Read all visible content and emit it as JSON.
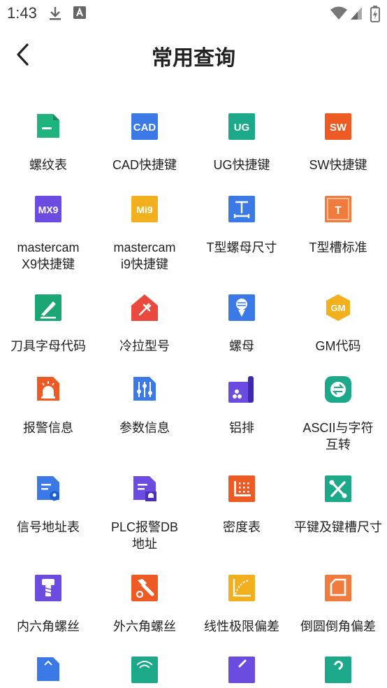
{
  "status": {
    "time": "1:43"
  },
  "header": {
    "title": "常用查询"
  },
  "items": [
    {
      "label": "螺纹表",
      "icon": "document-icon",
      "color": "#1fb37d"
    },
    {
      "label": "CAD快捷键",
      "icon": "cad-icon",
      "badge": "CAD",
      "color": "#3b7ae6"
    },
    {
      "label": "UG快捷键",
      "icon": "ug-icon",
      "badge": "UG",
      "color": "#1ba98a"
    },
    {
      "label": "SW快捷键",
      "icon": "sw-icon",
      "badge": "SW",
      "color": "#ee5a24"
    },
    {
      "label": "mastercam X9快捷键",
      "icon": "mx9-icon",
      "badge": "MX9",
      "color": "#6b4be0"
    },
    {
      "label": "mastercam i9快捷键",
      "icon": "mi9-icon",
      "badge": "Mi9",
      "color": "#f2b01e"
    },
    {
      "label": "T型螺母尺寸",
      "icon": "t-nut-icon",
      "badge": "T",
      "color": "#3b7ae6"
    },
    {
      "label": "T型槽标准",
      "icon": "t-slot-icon",
      "badge": "T",
      "color": "#f07b3c"
    },
    {
      "label": "刀具字母代码",
      "icon": "cutter-icon",
      "color": "#1aa774"
    },
    {
      "label": "冷拉型号",
      "icon": "house-plug-icon",
      "color": "#ea4a3e"
    },
    {
      "label": "螺母",
      "icon": "nut-icon",
      "color": "#3b7ae6"
    },
    {
      "label": "GM代码",
      "icon": "gm-icon",
      "badge": "GM",
      "color": "#f2b01e"
    },
    {
      "label": "报警信息",
      "icon": "alarm-icon",
      "color": "#ee5a24"
    },
    {
      "label": "参数信息",
      "icon": "sliders-icon",
      "color": "#3b7ae6"
    },
    {
      "label": "铝排",
      "icon": "aluminum-icon",
      "color": "#6b4be0"
    },
    {
      "label": "ASCII与字符互转",
      "icon": "convert-icon",
      "color": "#1ba98a"
    },
    {
      "label": "信号地址表",
      "icon": "location-doc-icon",
      "color": "#3b7ae6"
    },
    {
      "label": "PLC报警DB地址",
      "icon": "plc-alarm-icon",
      "color": "#6b4be0"
    },
    {
      "label": "密度表",
      "icon": "density-grid-icon",
      "color": "#ee5a24"
    },
    {
      "label": "平键及键槽尺寸",
      "icon": "tools-icon",
      "color": "#1ba98a"
    },
    {
      "label": "内六角螺丝",
      "icon": "hex-socket-screw-icon",
      "color": "#6b4be0"
    },
    {
      "label": "外六角螺丝",
      "icon": "hex-bolt-icon",
      "color": "#ee5a24"
    },
    {
      "label": "线性极限偏差",
      "icon": "linear-deviation-icon",
      "color": "#f2b01e"
    },
    {
      "label": "倒圆倒角偏差",
      "icon": "chamfer-icon",
      "color": "#f07b3c"
    },
    {
      "label": "",
      "icon": "partial-blue-icon",
      "color": "#3b7ae6"
    },
    {
      "label": "",
      "icon": "partial-green-icon",
      "color": "#1ba98a"
    },
    {
      "label": "",
      "icon": "partial-purple-icon",
      "color": "#6b4be0"
    },
    {
      "label": "",
      "icon": "partial-teal-icon",
      "color": "#1ba98a"
    }
  ]
}
